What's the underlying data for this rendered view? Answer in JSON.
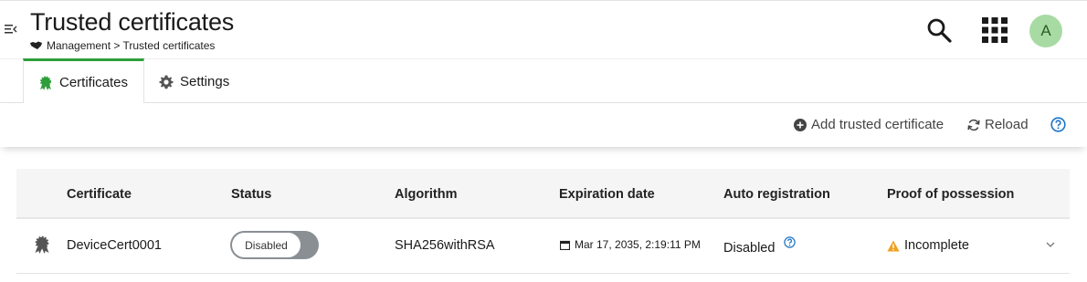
{
  "header": {
    "title": "Trusted certificates",
    "breadcrumb": "Management > Trusted certificates",
    "avatar_initial": "A"
  },
  "tabs": [
    {
      "label": "Certificates",
      "active": true,
      "icon": "certificate-icon"
    },
    {
      "label": "Settings",
      "active": false,
      "icon": "gear-icon"
    }
  ],
  "toolbar": {
    "add_label": "Add trusted certificate",
    "reload_label": "Reload"
  },
  "table": {
    "columns": [
      "Certificate",
      "Status",
      "Algorithm",
      "Expiration date",
      "Auto registration",
      "Proof of possession"
    ],
    "rows": [
      {
        "certificate": "DeviceCert0001",
        "status": "Disabled",
        "algorithm": "SHA256withRSA",
        "expiration": "Mar 17, 2035, 2:19:11 PM",
        "auto_registration": "Disabled",
        "proof_of_possession": "Incomplete"
      }
    ]
  },
  "colors": {
    "accent": "#2e9e3a",
    "avatar_bg": "#a8dba3",
    "help": "#1a73c8",
    "warning": "#f0a020"
  }
}
